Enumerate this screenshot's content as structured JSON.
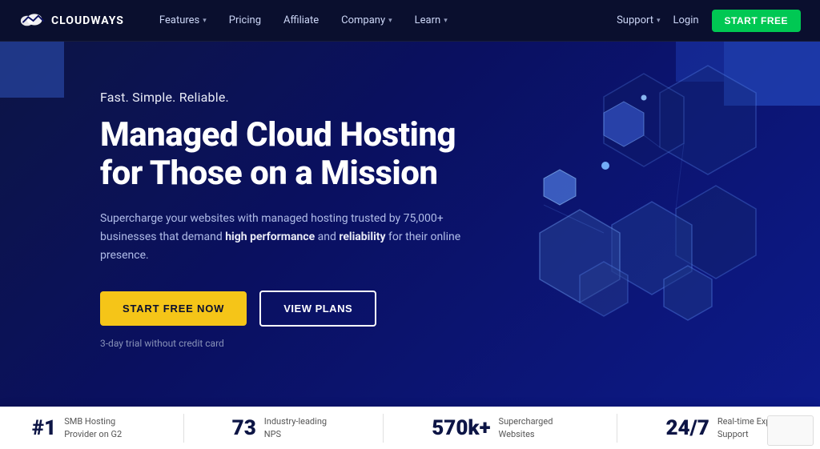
{
  "brand": {
    "name": "CLOUDWAYS",
    "logo_alt": "Cloudways logo"
  },
  "navbar": {
    "links": [
      {
        "label": "Features",
        "has_dropdown": true
      },
      {
        "label": "Pricing",
        "has_dropdown": false
      },
      {
        "label": "Affiliate",
        "has_dropdown": false
      },
      {
        "label": "Company",
        "has_dropdown": true
      },
      {
        "label": "Learn",
        "has_dropdown": true
      }
    ],
    "support_label": "Support",
    "login_label": "Login",
    "start_free_label": "START FREE"
  },
  "hero": {
    "tagline": "Fast. Simple. Reliable.",
    "title_line1": "Managed Cloud Hosting",
    "title_line2": "for Those on a Mission",
    "description": "Supercharge your websites with managed hosting trusted by 75,000+ businesses that demand high performance and reliability for their online presence.",
    "cta_primary": "START FREE NOW",
    "cta_secondary": "VIEW PLANS",
    "trial_note": "3-day trial without credit card"
  },
  "stats": [
    {
      "number": "#1",
      "label": "SMB Hosting Provider on G2"
    },
    {
      "number": "73",
      "label": "Industry-leading NPS"
    },
    {
      "number": "570k+",
      "label": "Supercharged Websites"
    },
    {
      "number": "24/7",
      "label": "Real-time Expert Support"
    }
  ]
}
